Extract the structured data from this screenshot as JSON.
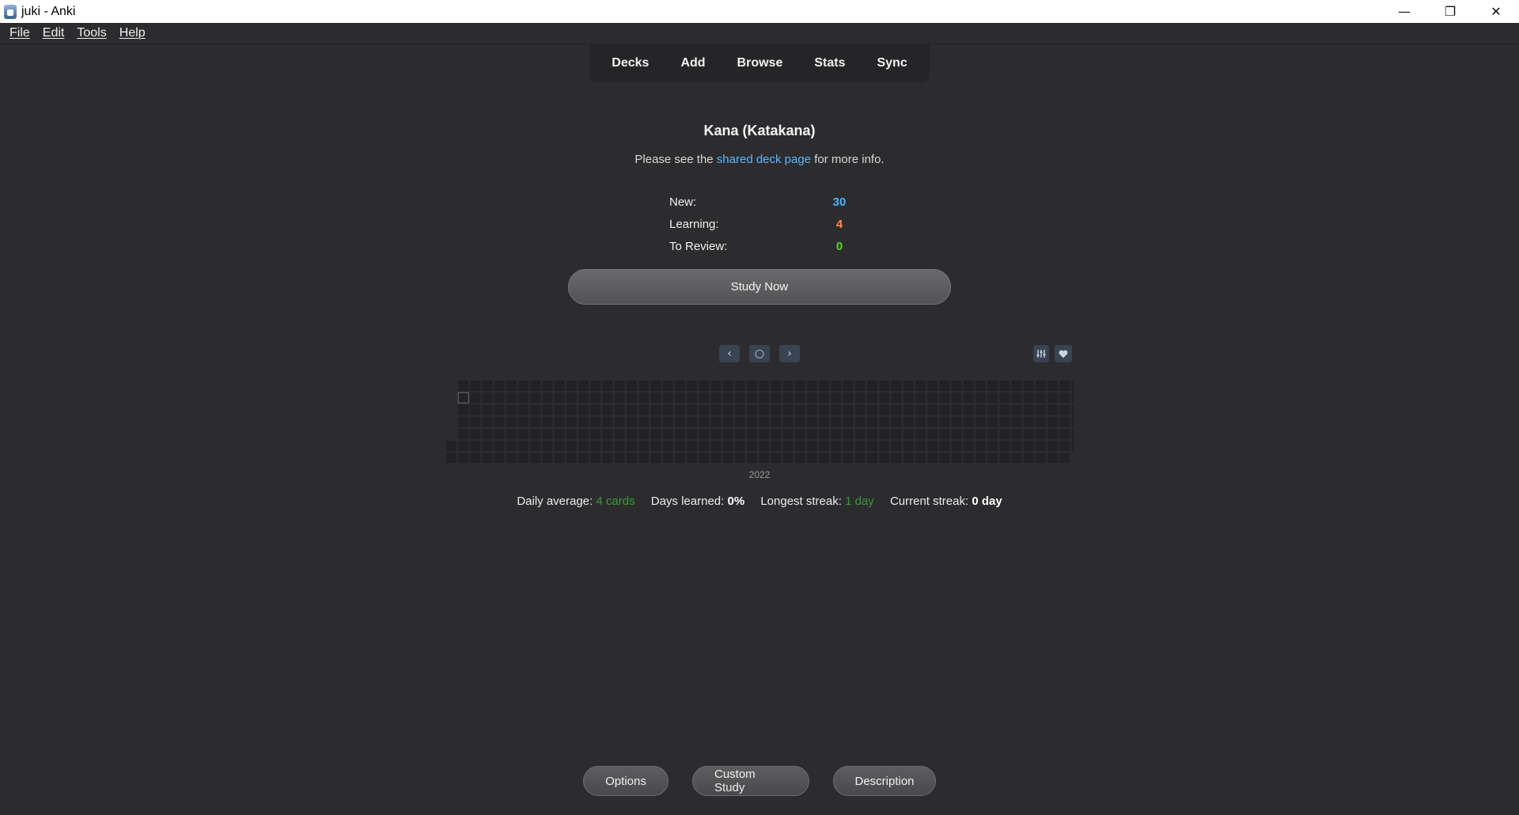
{
  "window": {
    "title": "juki - Anki",
    "controls": {
      "minimize": "—",
      "restore": "❐",
      "close": "✕"
    }
  },
  "menu": [
    "File",
    "Edit",
    "Tools",
    "Help"
  ],
  "nav": [
    "Decks",
    "Add",
    "Browse",
    "Stats",
    "Sync"
  ],
  "deck": {
    "title": "Kana (Katakana)",
    "desc_prefix": "Please see the ",
    "desc_link": "shared deck page",
    "desc_suffix": " for more info."
  },
  "counts": [
    {
      "label": "New:",
      "value": "30",
      "color": "#4fb3ff"
    },
    {
      "label": "Learning:",
      "value": "4",
      "color": "#ff8a50"
    },
    {
      "label": "To Review:",
      "value": "0",
      "color": "#5ed12f"
    }
  ],
  "study_button": "Study Now",
  "heatmap_controls": {
    "prev_icon": "‹",
    "today_icon": "○",
    "next_icon": "›",
    "options_icon": "sliders-icon",
    "heart_icon": "heart-icon"
  },
  "heatmap": {
    "year": "2022",
    "cell_color": "#222224",
    "highlight_border": "#6a6a6a"
  },
  "summary": {
    "daily_avg_label": "Daily average:",
    "daily_avg_value": "4 cards",
    "days_learned_label": "Days learned:",
    "days_learned_value": "0%",
    "longest_streak_label": "Longest streak:",
    "longest_streak_value": "1 day",
    "current_streak_label": "Current streak:",
    "current_streak_value": "0 day"
  },
  "bottom_buttons": [
    "Options",
    "Custom Study",
    "Description"
  ]
}
